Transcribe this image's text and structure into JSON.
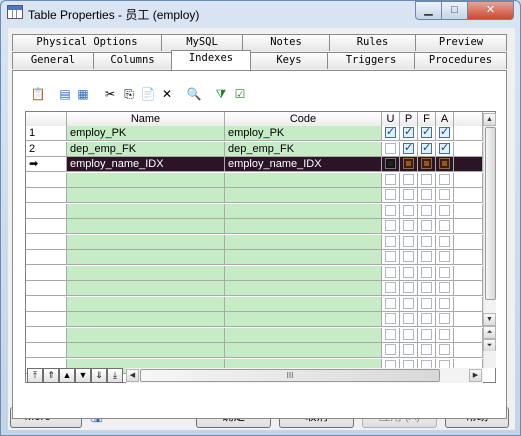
{
  "window": {
    "title": "Table Properties - 员工 (employ)",
    "controls": {
      "minimize": "▁",
      "maximize": "□",
      "close": "✕"
    }
  },
  "tabs_back": [
    "Physical Options",
    "MySQL",
    "Notes",
    "Rules",
    "Preview"
  ],
  "tabs_front": [
    "General",
    "Columns",
    "Indexes",
    "Keys",
    "Triggers",
    "Procedures"
  ],
  "active_tab": "Indexes",
  "toolbar": [
    "properties-icon",
    "add-row-icon",
    "insert-row-icon",
    "cut-icon",
    "copy-icon",
    "paste-icon",
    "delete-icon",
    "find-icon",
    "filter-icon",
    "customize-columns-icon"
  ],
  "grid": {
    "headers": {
      "name": "Name",
      "code": "Code",
      "u": "U",
      "p": "P",
      "f": "F",
      "a": "A"
    },
    "rows": [
      {
        "num": "1",
        "name": "employ_PK",
        "code": "employ_PK",
        "u": true,
        "p": true,
        "f": false,
        "a": false
      },
      {
        "num": "2",
        "name": "dep_emp_FK",
        "code": "dep_emp_FK",
        "u": false,
        "p": false,
        "f": true,
        "a": false
      },
      {
        "num": "➡",
        "name": "employ_name_IDX",
        "code": "employ_name_IDX",
        "u": false,
        "p": false,
        "f": false,
        "a": false,
        "selected": true
      }
    ],
    "empty_rows": 13,
    "hscroll_grip": "III"
  },
  "nav_buttons": [
    "⤒",
    "⇑",
    "▲",
    "▼",
    "⇓",
    "⤓"
  ],
  "buttons": {
    "more": "More >>",
    "ok": "确定",
    "cancel": "取消",
    "apply": "应用 (A)",
    "help": "帮助"
  },
  "colors": {
    "grid_green": "#c6ecc6",
    "selected_row": "#2b1426",
    "checkbox_checked": "#3b6fb3"
  }
}
